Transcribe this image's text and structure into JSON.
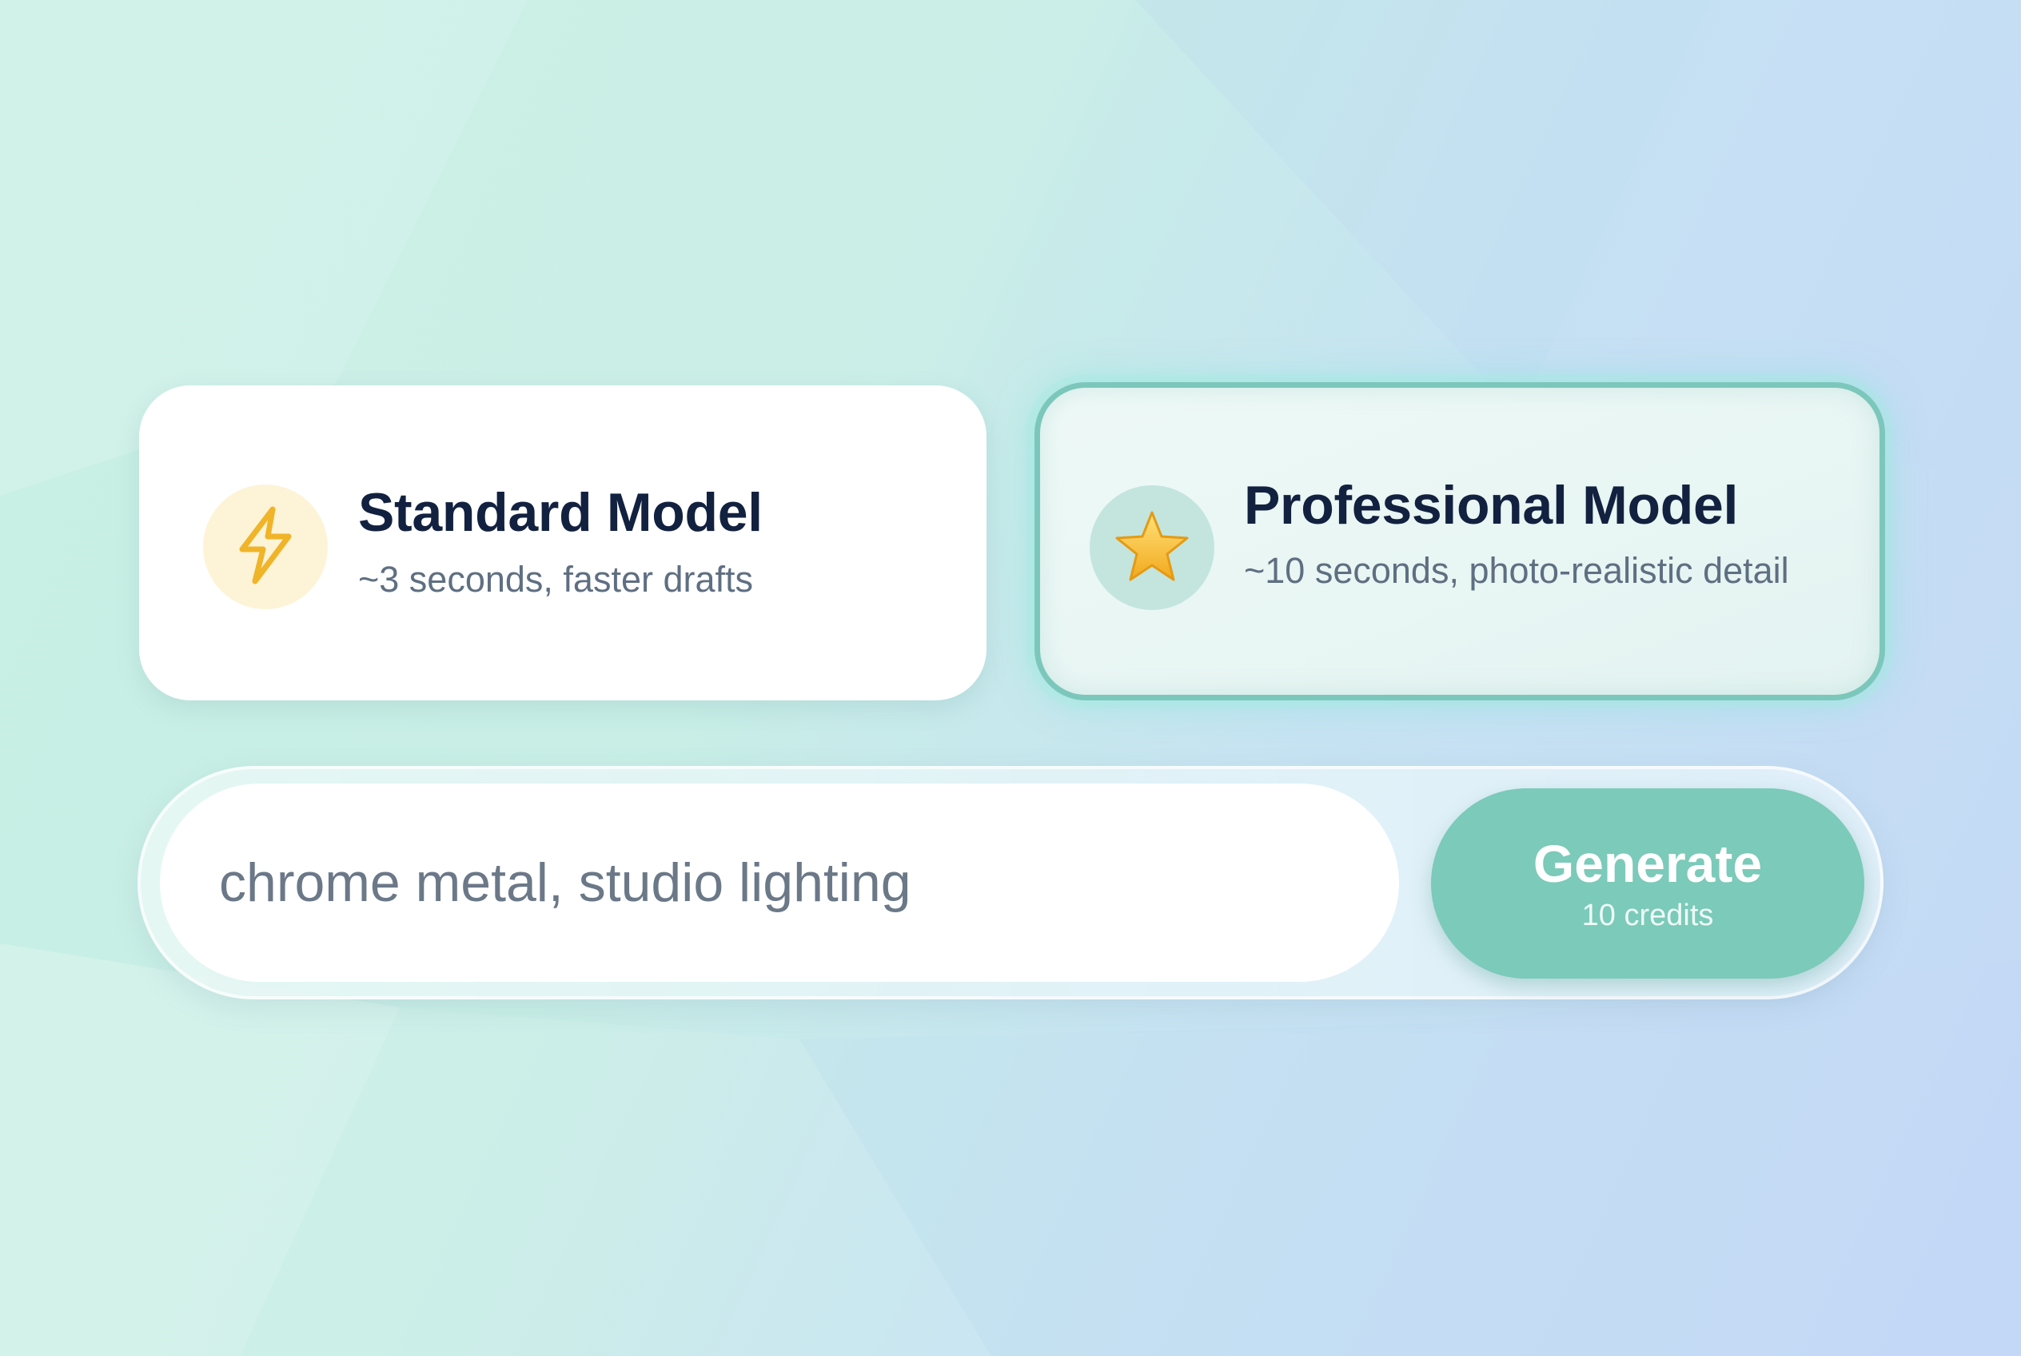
{
  "models": [
    {
      "id": "standard",
      "title": "Standard Model",
      "description": "~3 seconds, faster drafts",
      "icon": "lightning-icon",
      "selected": false
    },
    {
      "id": "professional",
      "title": "Professional Model",
      "description": "~10 seconds, photo-realistic detail",
      "icon": "star-icon",
      "selected": true
    }
  ],
  "prompt": {
    "value": "chrome metal, studio lighting",
    "placeholder": ""
  },
  "generate": {
    "label": "Generate",
    "credits": "10 credits"
  },
  "colors": {
    "accent": "#7ccab9",
    "selected_border": "#7cc7bb",
    "title_text": "#132140",
    "muted_text": "#5f6f82"
  }
}
